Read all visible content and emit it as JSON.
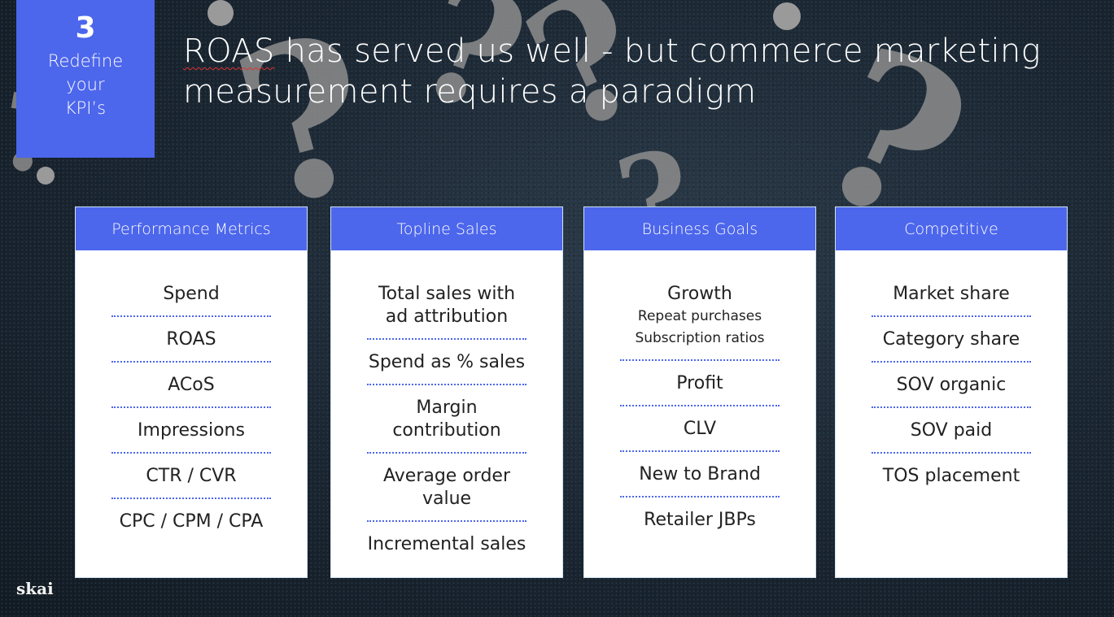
{
  "badge": {
    "number": "3",
    "line1": "Redefine",
    "line2": "your",
    "line3": "KPI’s"
  },
  "title": {
    "word1": "ROAS",
    "rest_line1": " has served us well - but commerce marketing",
    "line2": "measurement requires a paradigm"
  },
  "colors": {
    "accent": "#4c66ec",
    "separator": "#4c66ec"
  },
  "columns": [
    {
      "header": "Performance Metrics",
      "items": [
        {
          "label": "Spend"
        },
        {
          "label": "ROAS"
        },
        {
          "label": "ACoS"
        },
        {
          "label": "Impressions"
        },
        {
          "label": "CTR / CVR"
        },
        {
          "label": "CPC / CPM / CPA"
        }
      ]
    },
    {
      "header": "Topline Sales",
      "items": [
        {
          "label": "Total sales with ad attribution"
        },
        {
          "label": "Spend as % sales"
        },
        {
          "label": "Margin contribution"
        },
        {
          "label": "Average order value"
        },
        {
          "label": "Incremental sales"
        }
      ]
    },
    {
      "header": "Business Goals",
      "items": [
        {
          "label": "Growth",
          "sub1": "Repeat purchases",
          "sub2": "Subscription ratios"
        },
        {
          "label": "Profit"
        },
        {
          "label": "CLV"
        },
        {
          "label": "New to Brand"
        },
        {
          "label": "Retailer JBPs"
        }
      ]
    },
    {
      "header": "Competitive",
      "items": [
        {
          "label": "Market share"
        },
        {
          "label": "Category share"
        },
        {
          "label": "SOV organic"
        },
        {
          "label": "SOV paid"
        },
        {
          "label": "TOS placement"
        }
      ]
    }
  ],
  "logo": "skai"
}
